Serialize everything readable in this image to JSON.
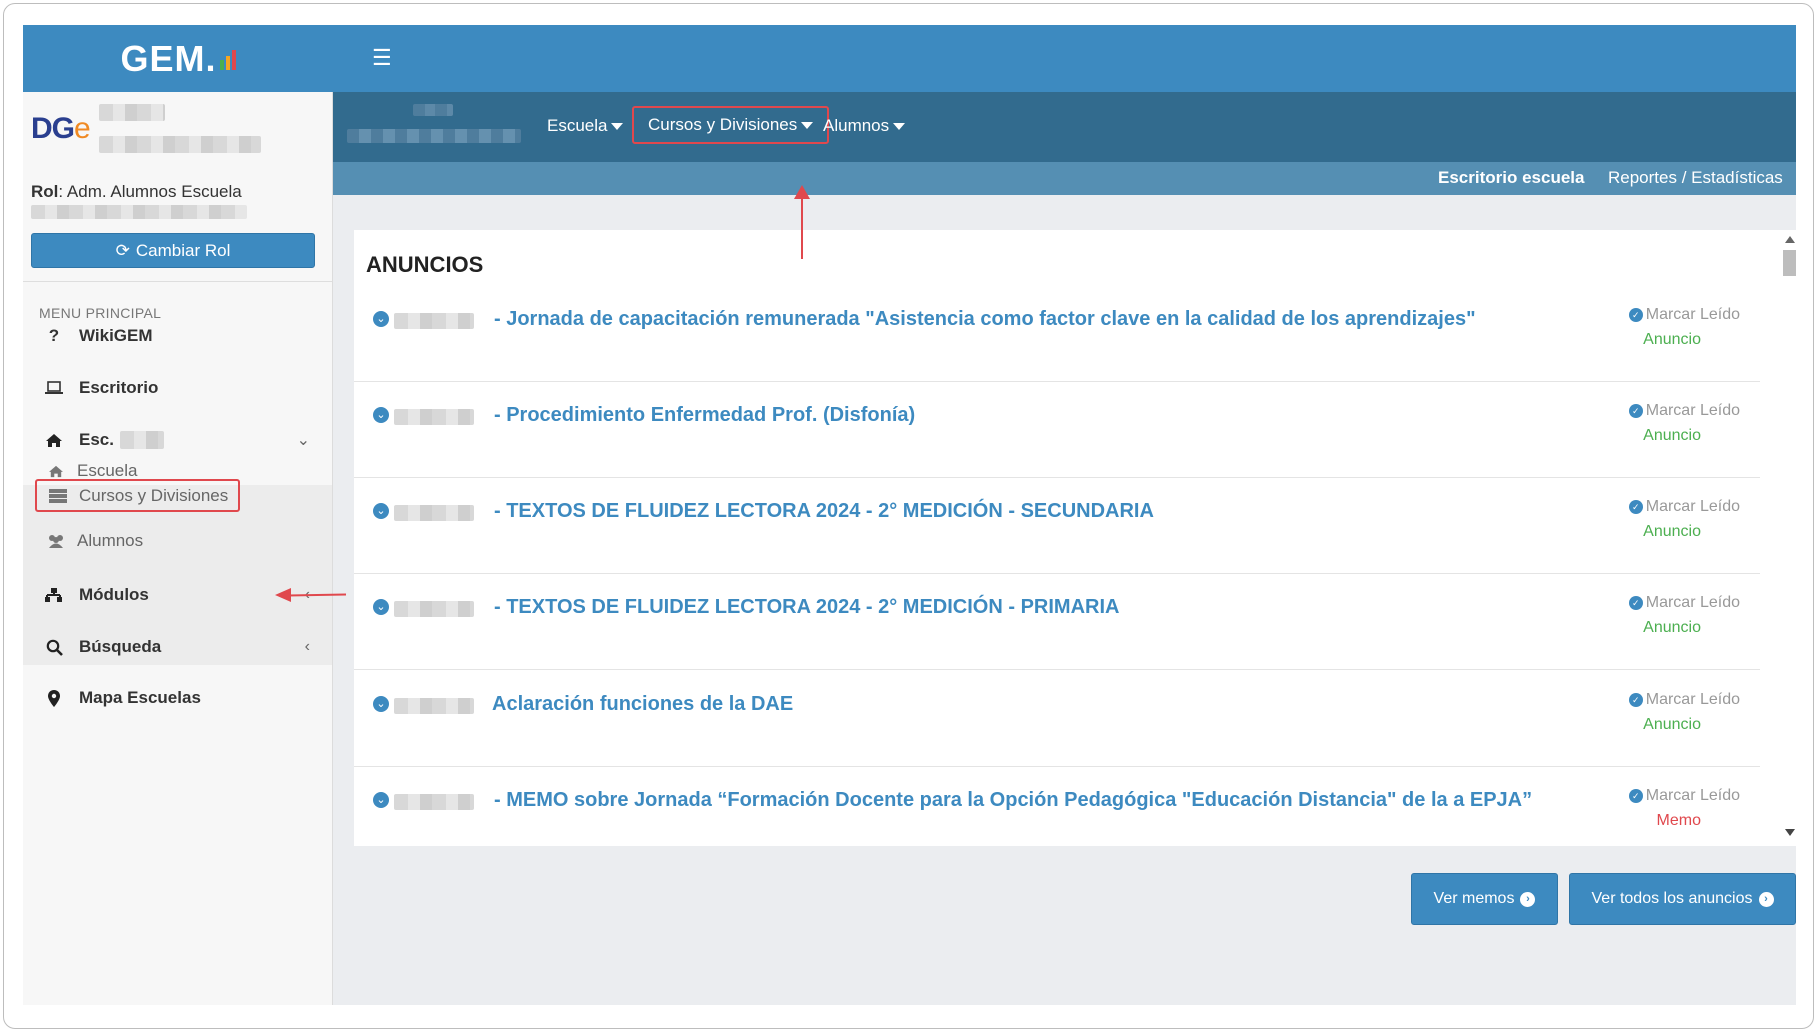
{
  "app": {
    "logo_text": "GEM",
    "logo_bar_colors": [
      "#4caf50",
      "#f5a623",
      "#e0484d"
    ]
  },
  "topbar": {
    "menu_icon": "hamburger-icon"
  },
  "sidebar": {
    "org_logo": {
      "text": "DG",
      "accent": "e"
    },
    "role_label": "Rol",
    "role_value": ": Adm. Alumnos Escuela",
    "change_role_label": "Cambiar Rol",
    "menu_header": "MENU PRINCIPAL",
    "items": [
      {
        "label": "WikiGEM",
        "icon": "question-icon"
      },
      {
        "label": "Escritorio",
        "icon": "laptop-icon"
      },
      {
        "label": "Esc.",
        "icon": "home-icon"
      },
      {
        "label": "Módulos",
        "icon": "sitemap-icon"
      },
      {
        "label": "Búsqueda",
        "icon": "search-icon"
      },
      {
        "label": "Mapa Escuelas",
        "icon": "map-marker-icon"
      }
    ],
    "sub_items": [
      {
        "label": "Escuela",
        "icon": "home-icon"
      },
      {
        "label": "Cursos y Divisiones",
        "icon": "server-icon"
      },
      {
        "label": "Alumnos",
        "icon": "users-icon"
      }
    ]
  },
  "subheader": {
    "menus": [
      {
        "label": "Escuela"
      },
      {
        "label": "Cursos y Divisiones"
      },
      {
        "label": "Alumnos"
      }
    ],
    "links": [
      {
        "label": "Escritorio escuela"
      },
      {
        "label": "Reportes / Estadísticas"
      }
    ]
  },
  "announcements": {
    "title": "ANUNCIOS",
    "mark_read_label": "Marcar Leído",
    "items": [
      {
        "title": "- Jornada de capacitación remunerada \"Asistencia como factor clave en la calidad de los aprendizajes\"",
        "type": "Anuncio",
        "type_color": "#4caf50"
      },
      {
        "title": "- Procedimiento Enfermedad Prof. (Disfonía)",
        "type": "Anuncio",
        "type_color": "#4caf50"
      },
      {
        "title": "- TEXTOS DE FLUIDEZ LECTORA 2024 - 2° MEDICIÓN - SECUNDARIA",
        "type": "Anuncio",
        "type_color": "#4caf50"
      },
      {
        "title": "- TEXTOS DE FLUIDEZ LECTORA 2024 - 2° MEDICIÓN - PRIMARIA",
        "type": "Anuncio",
        "type_color": "#4caf50"
      },
      {
        "title": "Aclaración funciones de la DAE",
        "type": "Anuncio",
        "type_color": "#4caf50"
      },
      {
        "title": "- MEMO sobre Jornada “Formación Docente para la Opción Pedagógica \"Educación Distancia\" de la a EPJA”",
        "type": "Memo",
        "type_color": "#e0484d"
      }
    ]
  },
  "buttons": {
    "ver_memos": "Ver memos",
    "ver_todos": "Ver todos los anuncios"
  },
  "colors": {
    "primary": "#3d8ac0",
    "subheader": "#326b8e",
    "highlight": "#e0484d"
  }
}
